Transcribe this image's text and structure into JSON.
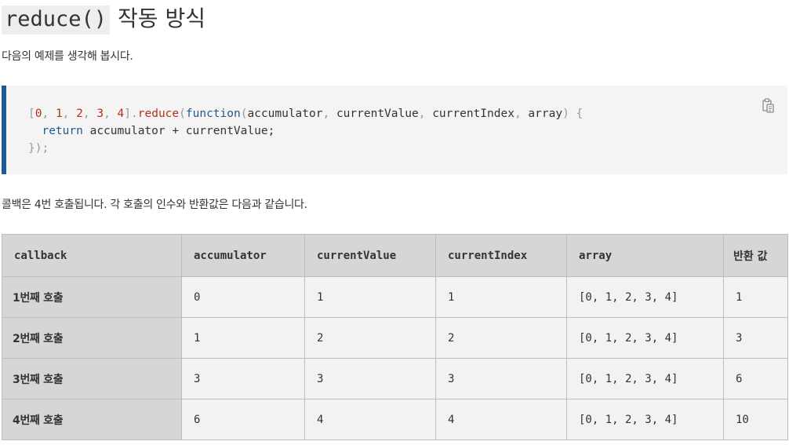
{
  "heading": {
    "code": "reduce()",
    "text": "작동 방식"
  },
  "intro": "다음의 예제를 생각해 봅시다.",
  "code_block": {
    "language": "javascript",
    "line1": {
      "array_items": [
        "0",
        "1",
        "2",
        "3",
        "4"
      ],
      "method": "reduce",
      "keyword": "function",
      "params": [
        "accumulator",
        "currentValue",
        "currentIndex",
        "array"
      ]
    },
    "line2": {
      "keyword": "return",
      "expression": "accumulator + currentValue;"
    },
    "line3": "});",
    "copy_icon": "clipboard-icon"
  },
  "summary": "콜백은 4번 호출됩니다. 각 호출의 인수와 반환값은 다음과 같습니다.",
  "table": {
    "headers": [
      "callback",
      "accumulator",
      "currentValue",
      "currentIndex",
      "array",
      "반환 값"
    ],
    "rows": [
      {
        "label": "1번째 호출",
        "accumulator": "0",
        "currentValue": "1",
        "currentIndex": "1",
        "array": "[0, 1, 2, 3, 4]",
        "return": "1"
      },
      {
        "label": "2번째 호출",
        "accumulator": "1",
        "currentValue": "2",
        "currentIndex": "2",
        "array": "[0, 1, 2, 3, 4]",
        "return": "3"
      },
      {
        "label": "3번째 호출",
        "accumulator": "3",
        "currentValue": "3",
        "currentIndex": "3",
        "array": "[0, 1, 2, 3, 4]",
        "return": "6"
      },
      {
        "label": "4번째 호출",
        "accumulator": "6",
        "currentValue": "4",
        "currentIndex": "4",
        "array": "[0, 1, 2, 3, 4]",
        "return": "10"
      }
    ]
  },
  "colors": {
    "code_border": "#1f5a96",
    "code_bg": "#f4f4f4",
    "keyword": "#1d5a8e",
    "number": "#b5301a",
    "header_bg": "#d6d6d6",
    "cell_bg": "#f2f2f2"
  }
}
